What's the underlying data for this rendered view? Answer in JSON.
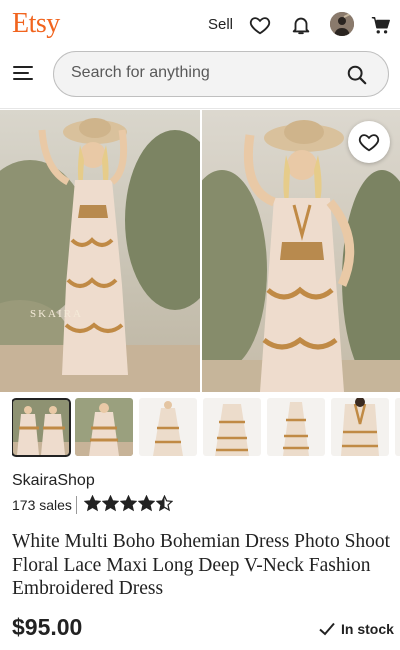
{
  "header": {
    "logo_text": "Etsy",
    "sell_label": "Sell",
    "icons": [
      "heart-icon",
      "bell-icon",
      "avatar",
      "cart-icon"
    ],
    "brand_color": "#F1641E"
  },
  "search": {
    "placeholder": "Search for anything"
  },
  "gallery": {
    "main_image_watermark": "SKAIRA",
    "thumbnail_count": 7
  },
  "listing": {
    "shop_name": "SkairaShop",
    "sales": "173 sales",
    "rating": 4.5,
    "rating_max": 5,
    "title": "White Multi Boho Bohemian Dress Photo Shoot Floral Lace Maxi Long Deep V-Neck Fashion Embroidered Dress",
    "price": "$95.00",
    "stock_status": "In stock"
  }
}
